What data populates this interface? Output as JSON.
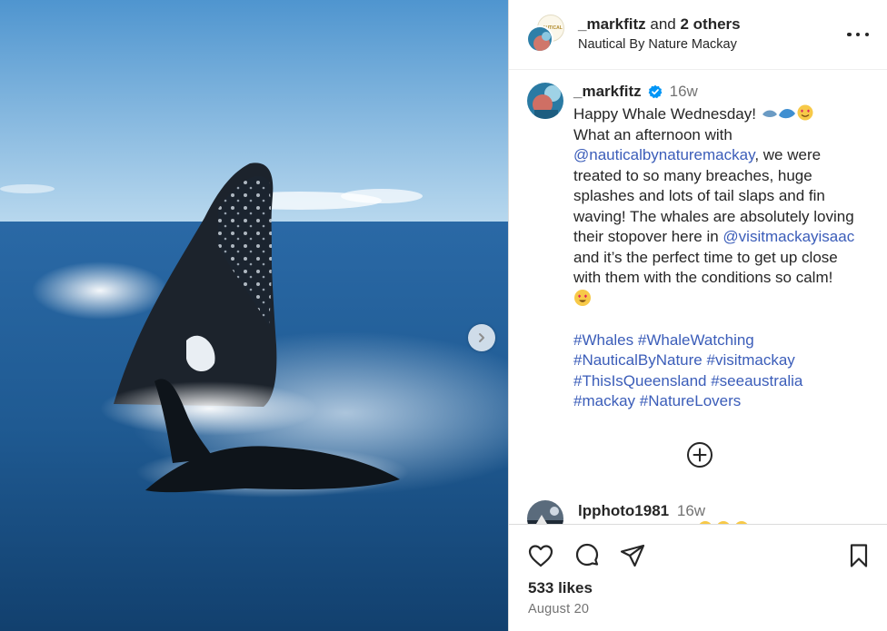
{
  "photo": {
    "alt": ""
  },
  "header": {
    "user": "_markfitz",
    "and_text": "and",
    "others": "2 others",
    "location": "Nautical By Nature Mackay",
    "avatar_badge_text": "NAUTICAL"
  },
  "caption": {
    "user": "_markfitz",
    "time_ago": "16w",
    "line1": "Happy Whale Wednesday!",
    "line2": "What an afternoon with",
    "mention1": "@nauticalbynaturemackay",
    "line3_rest": ", we were",
    "line4": "treated to so many breaches, huge",
    "line5": "splashes and lots of tail slaps and fin",
    "line6": "waving! The whales are absolutely loving",
    "line7_pre": "their stopover here in ",
    "mention2": "@visitmackayisaac",
    "line8": "and it’s the perfect time to get up close",
    "line9": "with them with the conditions so calm!",
    "hashtags": [
      [
        "#Whales",
        "#WhaleWatching"
      ],
      [
        "#NauticalByNature",
        "#visitmackay"
      ],
      [
        "#ThisIsQueensland",
        "#seeaustralia"
      ],
      [
        "#mackay",
        "#NatureLovers"
      ]
    ]
  },
  "comment2": {
    "user": "lpphoto1981",
    "time_ago": "16w"
  },
  "footer": {
    "likes": "533 likes",
    "date": "August 20"
  },
  "colors": {
    "link": "#3b5db9",
    "verified": "#0095f6",
    "secondary": "#737373"
  },
  "icons": [
    "chevron-right-icon",
    "more-icon",
    "verified-icon",
    "plus-circle-icon",
    "heart-icon",
    "comment-icon",
    "share-icon",
    "bookmark-icon"
  ]
}
